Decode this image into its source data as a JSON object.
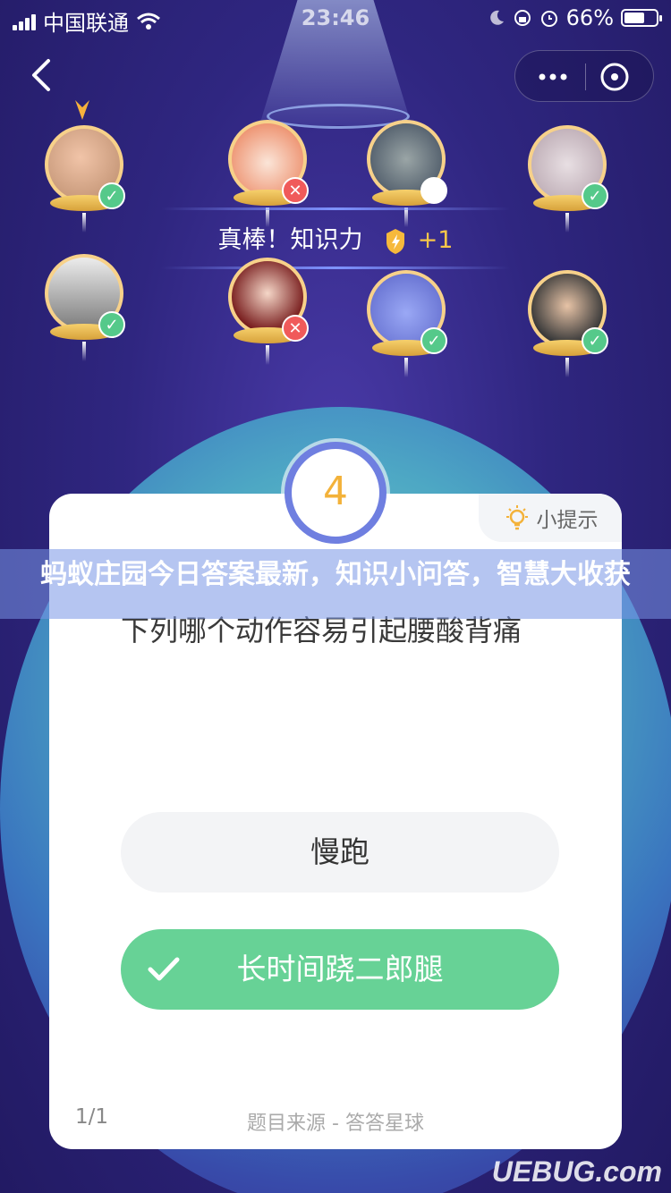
{
  "status_bar": {
    "carrier": "中国联通",
    "time": "23:46",
    "battery": "66%",
    "battery_level": 0.66
  },
  "feedback": {
    "text": "真棒！知识力",
    "bonus": "+1"
  },
  "players": [
    {
      "name": "player-1",
      "result": "correct",
      "leader": true
    },
    {
      "name": "player-2",
      "result": "wrong"
    },
    {
      "name": "player-3",
      "result": "pending"
    },
    {
      "name": "player-4",
      "result": "correct"
    },
    {
      "name": "player-5",
      "result": "correct"
    },
    {
      "name": "player-6",
      "result": "wrong"
    },
    {
      "name": "player-7",
      "result": "correct"
    },
    {
      "name": "player-8",
      "result": "correct"
    }
  ],
  "question": {
    "number": "4",
    "hint_label": "小提示",
    "text": "下列哪个动作容易引起腰酸背痛",
    "options": [
      "慢跑",
      "长时间跷二郎腿"
    ],
    "correct_index": 1,
    "progress": "1/1",
    "source": "题目来源 - 答答星球"
  },
  "banner": {
    "title": "蚂蚁庄园今日答案最新，知识小问答，智慧大收获"
  },
  "watermark": "UEBUG.com",
  "colors": {
    "correct": "#67d296",
    "wrong": "#f05a5a",
    "accent": "#6f7fe0",
    "number": "#f3b23a"
  }
}
